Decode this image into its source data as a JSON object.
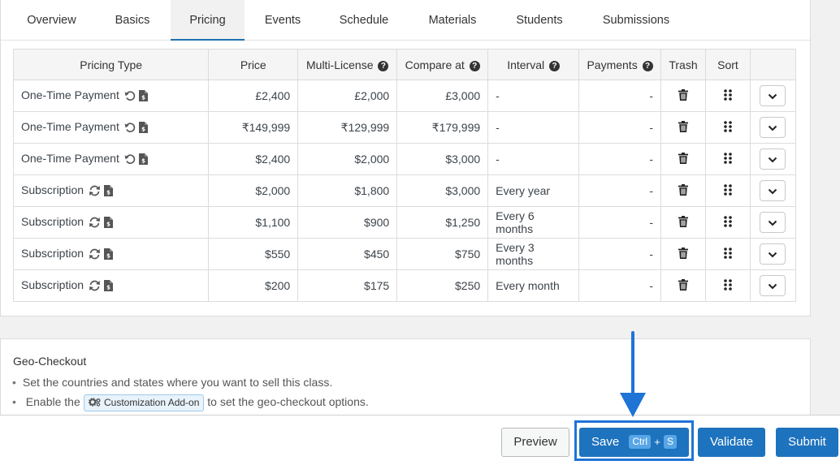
{
  "tabs": [
    {
      "label": "Overview"
    },
    {
      "label": "Basics"
    },
    {
      "label": "Pricing",
      "active": true
    },
    {
      "label": "Events"
    },
    {
      "label": "Schedule"
    },
    {
      "label": "Materials"
    },
    {
      "label": "Students"
    },
    {
      "label": "Submissions"
    }
  ],
  "pricing_table": {
    "headers": {
      "pricing_type": "Pricing Type",
      "price": "Price",
      "multi_license": "Multi-License",
      "compare_at": "Compare at",
      "interval": "Interval",
      "payments": "Payments",
      "trash": "Trash",
      "sort": "Sort"
    },
    "help_glyph": "?",
    "rows": [
      {
        "type": "One-Time Payment",
        "kind": "one-time",
        "price": "£2,400",
        "multi_license": "£2,000",
        "compare_at": "£3,000",
        "interval": "-",
        "payments": "-"
      },
      {
        "type": "One-Time Payment",
        "kind": "one-time",
        "price": "₹149,999",
        "multi_license": "₹129,999",
        "compare_at": "₹179,999",
        "interval": "-",
        "payments": "-"
      },
      {
        "type": "One-Time Payment",
        "kind": "one-time",
        "price": "$2,400",
        "multi_license": "$2,000",
        "compare_at": "$3,000",
        "interval": "-",
        "payments": "-"
      },
      {
        "type": "Subscription",
        "kind": "subscription",
        "price": "$2,000",
        "multi_license": "$1,800",
        "compare_at": "$3,000",
        "interval": "Every year",
        "payments": "-"
      },
      {
        "type": "Subscription",
        "kind": "subscription",
        "price": "$1,100",
        "multi_license": "$900",
        "compare_at": "$1,250",
        "interval": "Every 6 months",
        "payments": "-"
      },
      {
        "type": "Subscription",
        "kind": "subscription",
        "price": "$550",
        "multi_license": "$450",
        "compare_at": "$750",
        "interval": "Every 3 months",
        "payments": "-"
      },
      {
        "type": "Subscription",
        "kind": "subscription",
        "price": "$200",
        "multi_license": "$175",
        "compare_at": "$250",
        "interval": "Every month",
        "payments": "-"
      }
    ]
  },
  "geo_checkout": {
    "title": "Geo-Checkout",
    "line1": "Set the countries and states where you want to sell this class.",
    "line2_prefix": "Enable the",
    "addon_label": "Customization Add-on",
    "line2_suffix": "to set the geo-checkout options."
  },
  "footer": {
    "preview_label": "Preview",
    "save_label": "Save",
    "shortcut_key1": "Ctrl",
    "shortcut_plus": "+",
    "shortcut_key2": "S",
    "validate_label": "Validate",
    "submit_label": "Submit"
  },
  "colors": {
    "primary": "#1e73be",
    "highlight": "#1f74d6",
    "active_tab_underline": "#2271b1"
  },
  "icons": {
    "one_time_type": [
      "undo-icon",
      "invoice-icon"
    ],
    "subscription_type": [
      "sync-icon",
      "invoice-icon"
    ],
    "trash": "trash-icon",
    "sort": "drag-handle-icon",
    "expand": "chevron-down-icon",
    "help": "question-circle-icon",
    "addon": "cogs-icon",
    "annotation": "arrow-down-icon"
  }
}
